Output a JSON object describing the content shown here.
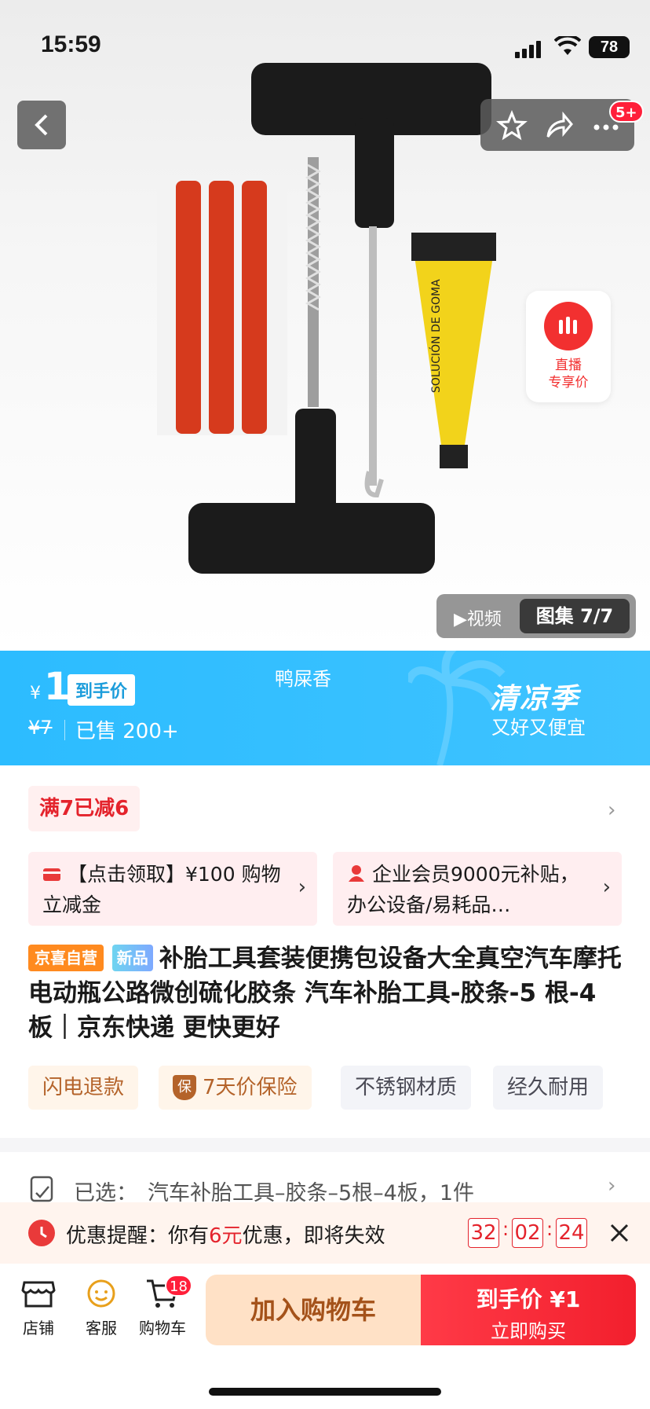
{
  "status_bar": {
    "time": "15:59",
    "battery": "78"
  },
  "top_bar": {
    "message_badge": "5+"
  },
  "live": {
    "line1": "直播",
    "line2": "专享价"
  },
  "gallery": {
    "video_label": "视频",
    "album_label": "图集 7/7"
  },
  "price_banner": {
    "currency": "¥",
    "price": "1",
    "price_tag": "到手价",
    "original_price": "¥7",
    "sold": "已售 200+",
    "shop_name": "鸭屎香",
    "season_title": "清凉季",
    "season_subtitle": "又好又便宜"
  },
  "promo": {
    "label": "满7已减6"
  },
  "coupons": [
    {
      "text": "【点击领取】¥100 购物立减金"
    },
    {
      "text": "企业会员9000元补贴，办公设备/易耗品…"
    }
  ],
  "product": {
    "badge_self": "京喜自营",
    "badge_new": "新品",
    "title": "补胎工具套装便携包设备大全真空汽车摩托电动瓶公路微创硫化胶条 汽车补胎工具-胶条-5 根-4 板｜京东快递 更快更好"
  },
  "features": [
    "闪电退款",
    "7天价保险",
    "不锈钢材质",
    "经久耐用"
  ],
  "feature_icon_text": "保",
  "selected": {
    "label": "已选：",
    "value": "汽车补胎工具–胶条–5根–4板，1件"
  },
  "reminder": {
    "prefix": "优惠提醒：你有",
    "amount": "6元",
    "suffix": "优惠，即将失效",
    "hours": "32",
    "minutes": "02",
    "seconds": "24",
    "colon": ":"
  },
  "bottom_bar": {
    "store": "店铺",
    "service": "客服",
    "cart": "购物车",
    "cart_count": "18",
    "add_to_cart": "加入购物车",
    "buy_line1": "到手价 ¥1",
    "buy_line2": "立即购买"
  },
  "colors": {
    "banner": "#2cbcff",
    "accent_red": "#f23030",
    "cart_button": "#ffe1c6"
  }
}
